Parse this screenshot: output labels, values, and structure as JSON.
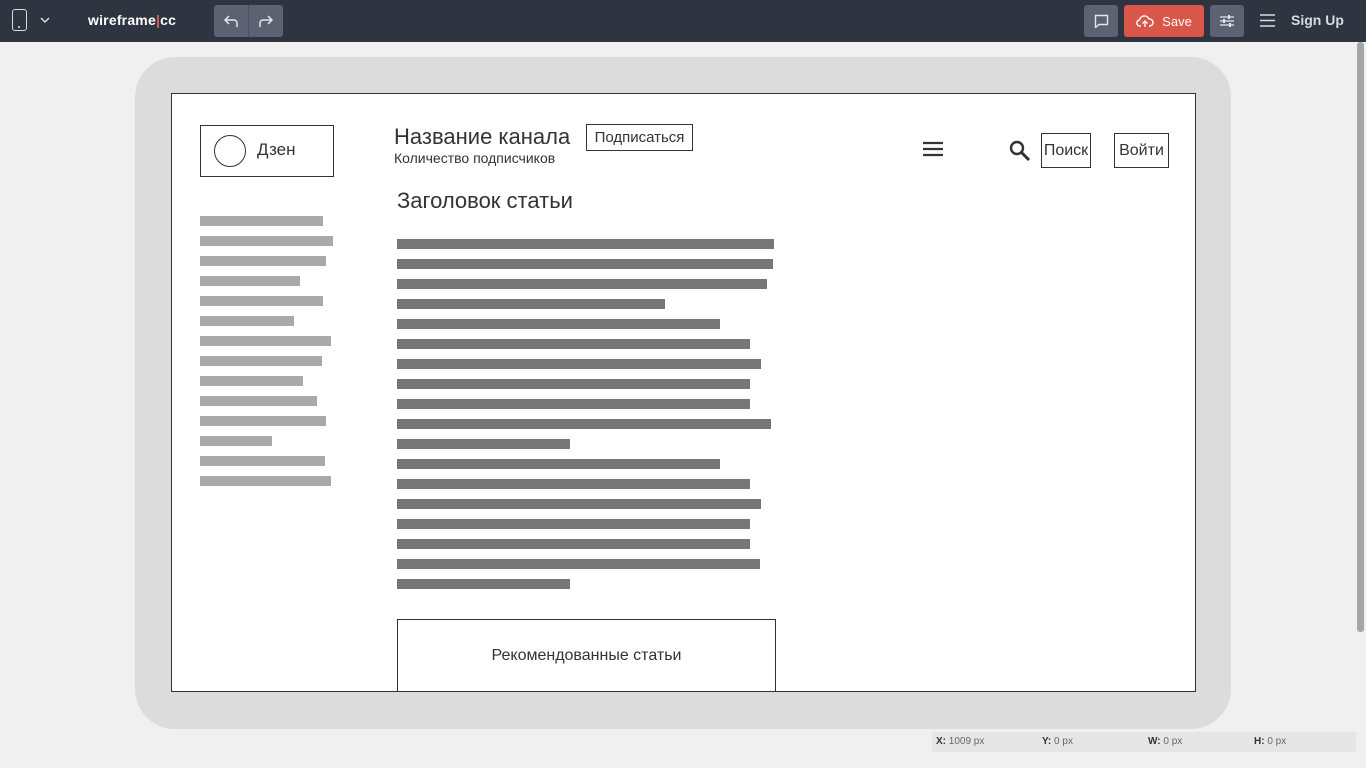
{
  "app": {
    "logo_main": "wireframe",
    "logo_sep": "|",
    "logo_suffix": "cc",
    "save_label": "Save",
    "signup_label": "Sign Up",
    "icons": {
      "device": "mobile-device-icon",
      "device_menu": "chevron-down-icon",
      "undo": "undo-icon",
      "redo": "redo-icon",
      "comment": "comment-icon",
      "save": "cloud-upload-icon",
      "settings": "sliders-icon",
      "menu": "hamburger-menu-icon"
    },
    "colors": {
      "topbar": "#2f3441",
      "save": "#d9564a",
      "tool_button": "#5c6271",
      "canvas": "#f0f0f0"
    }
  },
  "wireframe": {
    "logo_text": "Дзен",
    "channel_name": "Название канала",
    "subscriber_count": "Количество подписчиков",
    "subscribe_button": "Подписаться",
    "search_button": "Поиск",
    "login_button": "Войти",
    "article_title": "Заголовок статьи",
    "recommended": "Рекомендованные статьи",
    "sidebar_lines": 14,
    "text_lines": 18,
    "icons": {
      "menu": "hamburger-icon",
      "search": "search-icon",
      "logo": "circle-placeholder-icon"
    }
  },
  "status": {
    "x_label": "X:",
    "x_value": "1009 px",
    "y_label": "Y:",
    "y_value": "0 px",
    "w_label": "W:",
    "w_value": "0 px",
    "h_label": "H:",
    "h_value": "0 px"
  }
}
